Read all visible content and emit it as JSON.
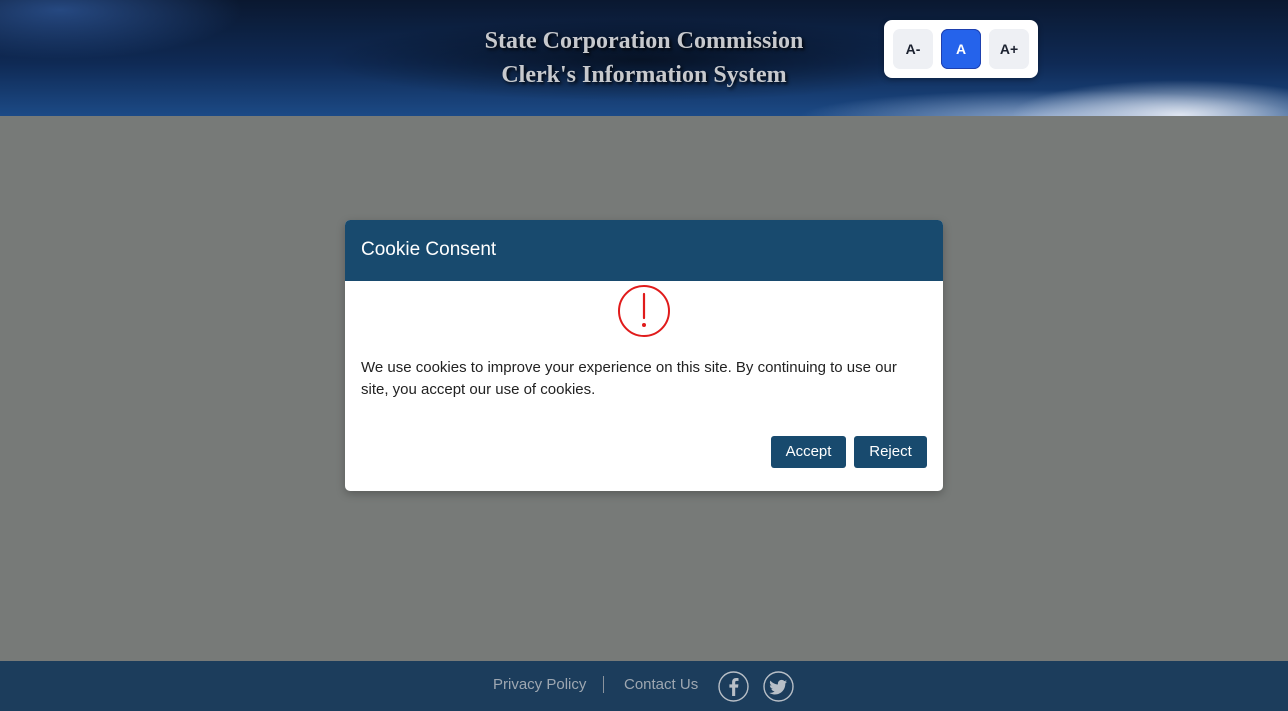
{
  "header": {
    "title_line1": "State Corporation Commission",
    "title_line2": "Clerk's Information System"
  },
  "font_size_controls": {
    "decrease_label": "A-",
    "default_label": "A",
    "increase_label": "A+",
    "active": "A"
  },
  "cookie_modal": {
    "title": "Cookie Consent",
    "icon": "exclamation-circle-icon",
    "message": "We use cookies to improve your experience on this site. By continuing to use our site, you accept our use of cookies.",
    "accept_label": "Accept",
    "reject_label": "Reject"
  },
  "footer": {
    "privacy_label": "Privacy Policy",
    "contact_label": "Contact Us",
    "social": [
      "facebook-icon",
      "twitter-icon"
    ]
  },
  "colors": {
    "modal_header": "#184a6e",
    "button": "#184a6e",
    "active_font_button": "#2563eb",
    "alert_icon": "#e01b1b",
    "footer": "#1c3d5c",
    "overlay": "#777a78"
  }
}
